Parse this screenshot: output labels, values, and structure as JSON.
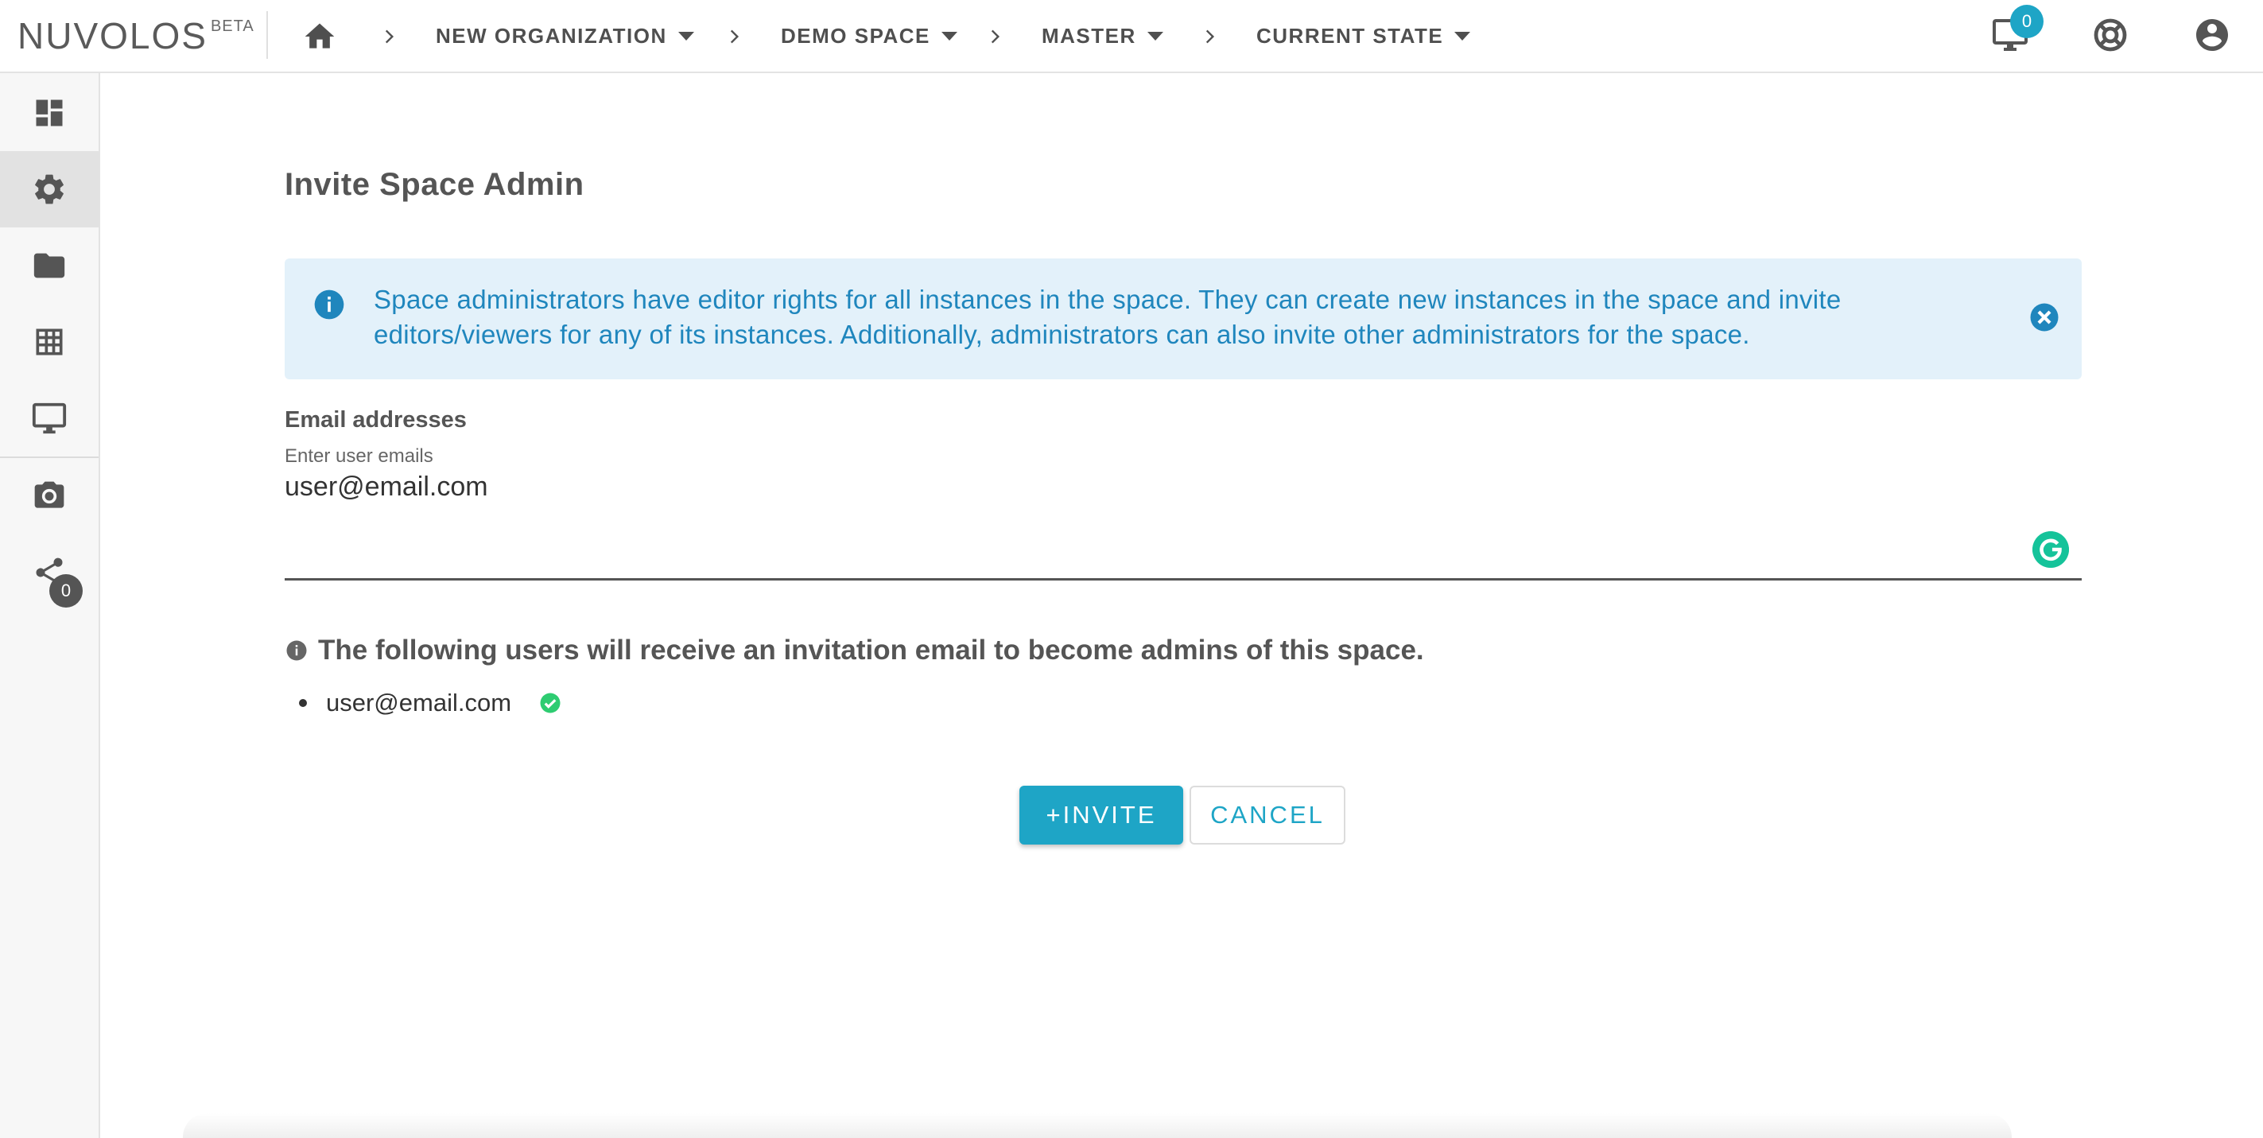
{
  "app": {
    "name": "NUVOLOS",
    "beta_label": "BETA"
  },
  "breadcrumb": [
    {
      "label": "NEW ORGANIZATION"
    },
    {
      "label": "DEMO SPACE"
    },
    {
      "label": "MASTER"
    },
    {
      "label": "CURRENT STATE"
    }
  ],
  "topbar": {
    "notifications_count": "0",
    "icons": [
      "home-icon",
      "desktop-icon",
      "lifebuoy-icon",
      "account-icon"
    ]
  },
  "sidebar": {
    "items": [
      {
        "name": "dashboard-icon"
      },
      {
        "name": "gear-icon",
        "active": true
      },
      {
        "name": "folder-icon"
      },
      {
        "name": "table-icon"
      },
      {
        "name": "monitor-icon"
      },
      {
        "name": "camera-icon"
      },
      {
        "name": "share-icon"
      }
    ],
    "share_badge": "0"
  },
  "main": {
    "title": "Invite Space Admin",
    "alert_text": "Space administrators have editor rights for all instances in the space. They can create new instances in the space and invite editors/viewers for any of its instances. Additionally, administrators can also invite other administrators for the space.",
    "email_label": "Email addresses",
    "email_sublabel": "Enter user emails",
    "email_value": "user@email.com",
    "info_heading": "The following users will receive an invitation email to become admins of this space.",
    "users": [
      "user@email.com"
    ],
    "invite_label": "+INVITE",
    "cancel_label": "CANCEL"
  },
  "colors": {
    "accent": "#1ea5c6",
    "alert_bg": "#e3f1fa",
    "alert_text": "#1f86bd",
    "success": "#2ecc71",
    "grammarly": "#15c39a"
  }
}
